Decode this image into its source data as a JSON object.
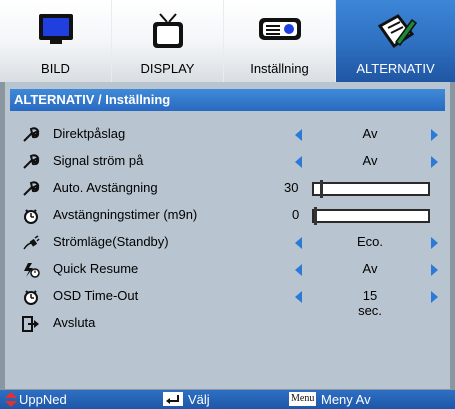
{
  "tabs": [
    {
      "label": "BILD",
      "icon": "monitor-icon"
    },
    {
      "label": "DISPLAY",
      "icon": "tv-icon"
    },
    {
      "label": "Inställning",
      "icon": "projector-icon"
    },
    {
      "label": "ALTERNATIV",
      "icon": "notepad-pen-icon",
      "active": true
    }
  ],
  "breadcrumb": "ALTERNATIV / Inställning",
  "rows": [
    {
      "label": "Direktpåslag",
      "value": "Av",
      "icon": "wrench-icon"
    },
    {
      "label": "Signal ström på",
      "value": "Av",
      "icon": "wrench-icon"
    },
    {
      "label": "Auto. Avstängning",
      "slider_value": "30",
      "slider_level": 0.05,
      "icon": "wrench-icon"
    },
    {
      "label": "Avstängningstimer (m9n)",
      "slider_value": "0",
      "slider_level": 0.0,
      "icon": "timer-icon"
    },
    {
      "label": "Strömläge(Standby)",
      "value": "Eco.",
      "icon": "power-plug-icon"
    },
    {
      "label": "Quick Resume",
      "value": "Av",
      "icon": "quick-resume-icon"
    },
    {
      "label": "OSD Time-Out",
      "value": "15 sec.",
      "icon": "timer-icon"
    },
    {
      "label": "Avsluta",
      "icon": "exit-icon"
    }
  ],
  "footer": {
    "updown": "UppNed",
    "select": "Välj",
    "menu_key": "Menu",
    "menu_off": "Meny Av"
  },
  "colors": {
    "accent": "#2b7bd6",
    "panel": "#b8c4cf",
    "frame": "#8a96a0"
  }
}
